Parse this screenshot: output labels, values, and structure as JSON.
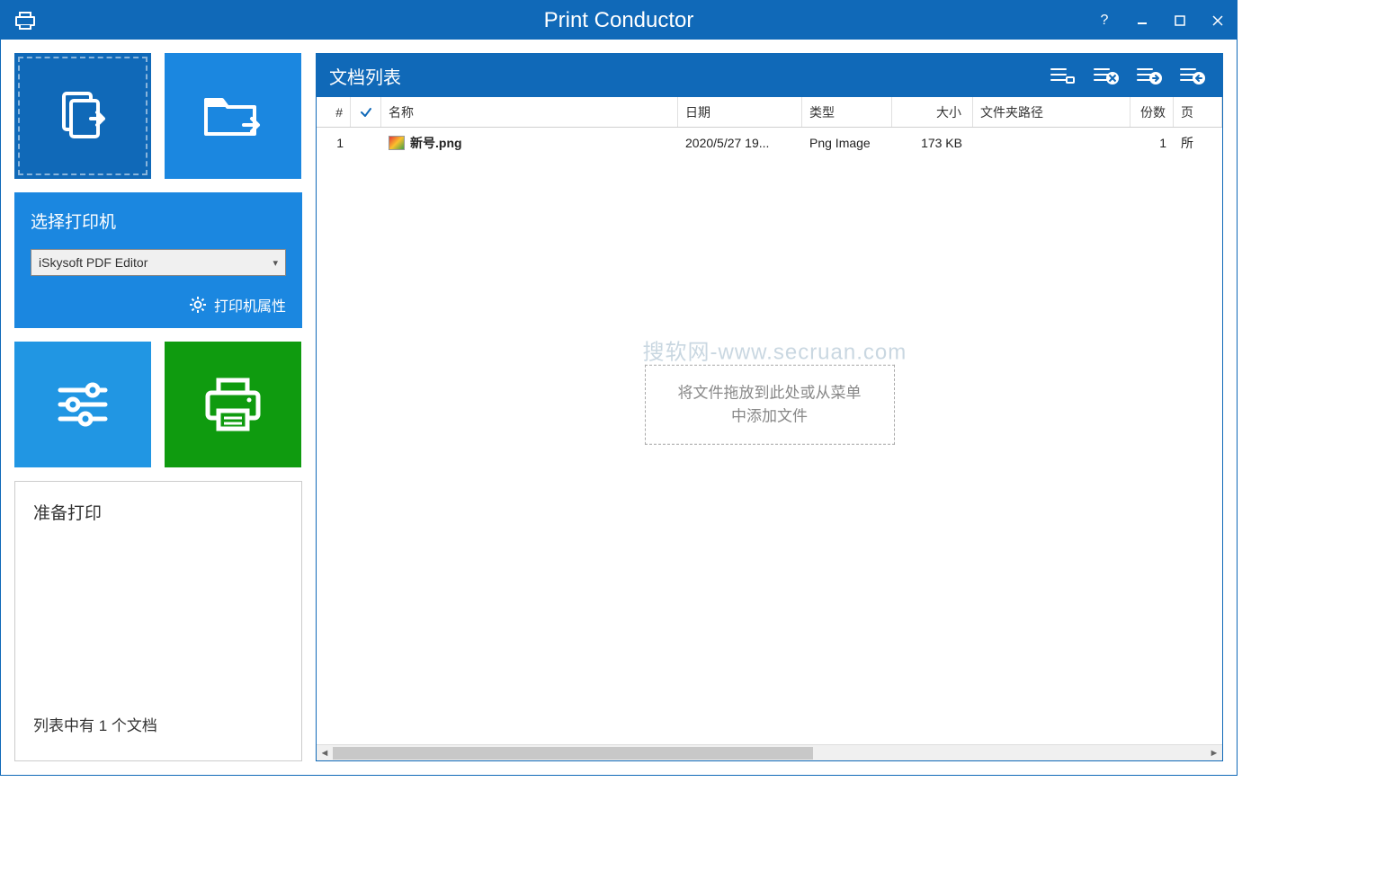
{
  "titlebar": {
    "title": "Print Conductor"
  },
  "sidebar": {
    "printer_panel_title": "选择打印机",
    "selected_printer": "iSkysoft PDF Editor",
    "printer_props": "打印机属性"
  },
  "status": {
    "title": "准备打印",
    "sub": "列表中有 1 个文档"
  },
  "list": {
    "title": "文档列表",
    "columns": {
      "num": "#",
      "name": "名称",
      "date": "日期",
      "type": "类型",
      "size": "大小",
      "path": "文件夹路径",
      "copies": "份数",
      "page": "页"
    },
    "rows": [
      {
        "num": "1",
        "name": "新号.png",
        "date": "2020/5/27 19...",
        "type": "Png Image",
        "size": "173 KB",
        "path": "",
        "copies": "1",
        "page": "所"
      }
    ],
    "dropzone_line1": "将文件拖放到此处或从菜单",
    "dropzone_line2": "中添加文件"
  },
  "watermark": "搜软网-www.secruan.com"
}
